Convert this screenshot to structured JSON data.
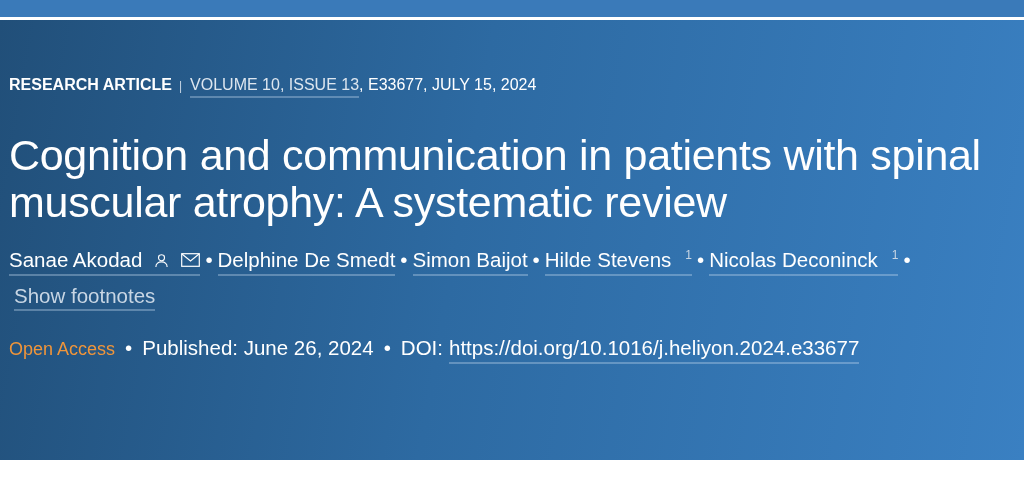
{
  "meta": {
    "article_type": "RESEARCH ARTICLE",
    "separator": "|",
    "volume_link": "VOLUME 10, ISSUE 13",
    "rest": ", E33677, JULY 15, 2024"
  },
  "title": "Cognition and communication in patients with spinal muscular atrophy: A systematic review",
  "author_separator": "•",
  "authors": [
    {
      "name": "Sanae Akodad",
      "person_icon": true,
      "mail_icon": true
    },
    {
      "name": "Delphine De Smedt"
    },
    {
      "name": "Simon Baijot"
    },
    {
      "name": "Hilde Stevens",
      "footnote": "1"
    },
    {
      "name": "Nicolas Deconinck",
      "footnote": "1"
    }
  ],
  "footnotes_toggle": "Show footnotes",
  "access": "Open Access",
  "published": "Published: June 26, 2024",
  "doi_label": "DOI:",
  "doi_link": "https://doi.org/10.1016/j.heliyon.2024.e33677"
}
